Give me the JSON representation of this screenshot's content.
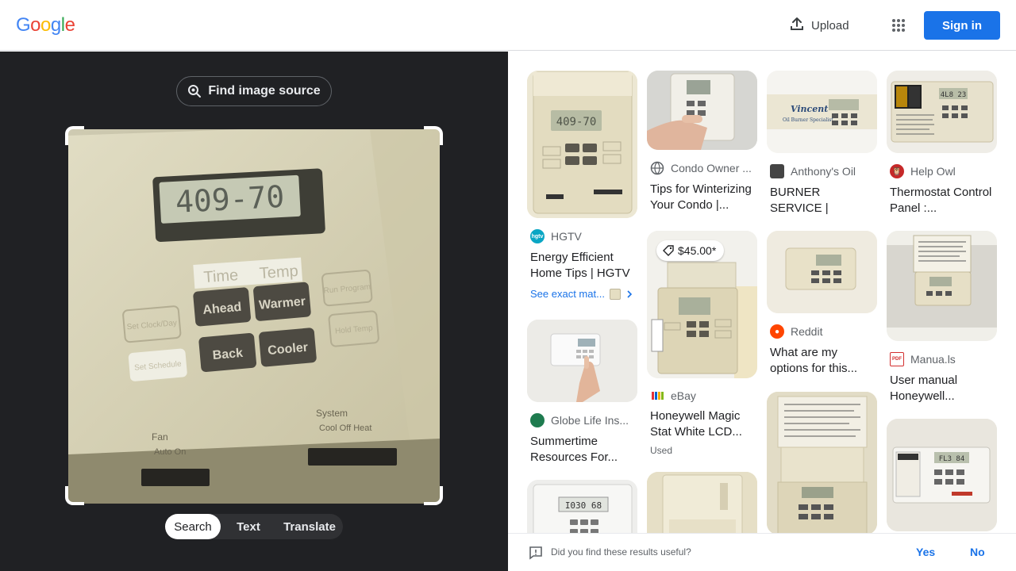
{
  "header": {
    "logo": [
      "G",
      "o",
      "o",
      "g",
      "l",
      "e"
    ],
    "logo_colors": [
      "#4285F4",
      "#EA4335",
      "#FBBC05",
      "#4285F4",
      "#34A853",
      "#EA4335"
    ],
    "upload_label": "Upload",
    "signin_label": "Sign in"
  },
  "lens": {
    "find_source_label": "Find image source",
    "image": {
      "lcd_text": "409-70",
      "label_time": "Time",
      "label_temp": "Temp",
      "btn_ahead": "Ahead",
      "btn_warmer": "Warmer",
      "btn_back": "Back",
      "btn_cooler": "Cooler",
      "btn_run_program": "Run Program",
      "btn_hold_temp": "Hold Temp",
      "btn_set_clock": "Set Clock/Day",
      "btn_set_schedule": "Set Schedule",
      "label_fan": "Fan",
      "label_fan_opts": "Auto  On",
      "label_system": "System",
      "label_system_opts": "Cool  Off  Heat"
    },
    "tabs": [
      "Search",
      "Text",
      "Translate"
    ],
    "active_tab": "Search"
  },
  "results": [
    {
      "source": "HGTV",
      "title": "Energy Efficient Home Tips | HGTV",
      "exact_match": "See exact mat...",
      "icon_color": "#0aa6c4",
      "icon_text": "hgtv",
      "thumb": "thermo-large-1"
    },
    {
      "source": "Globe Life Ins...",
      "title": "Summertime Resources For...",
      "icon_color": "#1e7b4f",
      "icon_text": "",
      "thumb": "thermo-hand-white"
    },
    {
      "source": "",
      "title": "",
      "thumb": "thermo-white-partial"
    },
    {
      "source": "Condo Owner ...",
      "title": "Tips for Winterizing Your Condo |...",
      "icon_color": "#5f6368",
      "icon_text": "",
      "thumb": "thermo-hand"
    },
    {
      "source": "eBay",
      "title": "Honeywell Magic Stat White LCD...",
      "sub": "Used",
      "price": "$45.00*",
      "icon_color": "#e53238",
      "icon_text": "",
      "thumb": "thermo-ebay"
    },
    {
      "source": "",
      "title": "",
      "thumb": "thermo-beige-partial"
    },
    {
      "source": "Anthony's Oil",
      "title": "BURNER SERVICE | Anthony's Oil",
      "icon_color": "#444",
      "icon_text": "",
      "thumb": "thermo-vincent"
    },
    {
      "source": "Reddit",
      "title": "What are my options for this...",
      "icon_color": "#ff4500",
      "icon_text": "",
      "thumb": "thermo-wall"
    },
    {
      "source": "",
      "title": "",
      "thumb": "thermo-open-door"
    },
    {
      "source": "Help Owl",
      "title": "Thermostat Control Panel :...",
      "icon_color": "#c62828",
      "icon_text": "",
      "thumb": "thermo-instructions"
    },
    {
      "source": "Manua.ls",
      "title": "User manual Honeywell...",
      "icon_color": "#d32f2f",
      "icon_text": "PDF",
      "thumb": "thermo-door-open"
    },
    {
      "source": "",
      "title": "",
      "thumb": "thermo-pro-white"
    }
  ],
  "feedback": {
    "question": "Did you find these results useful?",
    "yes": "Yes",
    "no": "No"
  }
}
